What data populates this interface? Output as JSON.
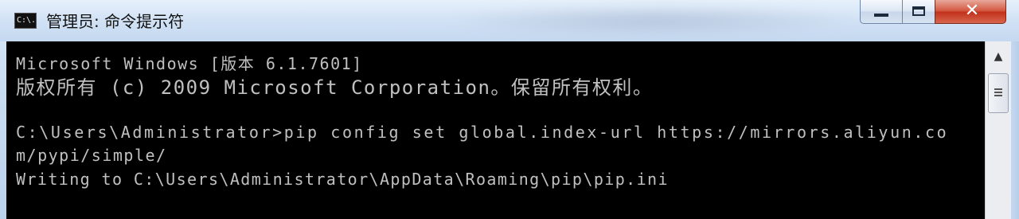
{
  "window": {
    "title": "管理员: 命令提示符",
    "icon_text": "C:\\."
  },
  "controls": {
    "minimize_icon": "minimize-icon",
    "maximize_icon": "maximize-icon",
    "close_glyph": "✕"
  },
  "console": {
    "lines": [
      "Microsoft Windows [版本 6.1.7601]",
      "版权所有 (c) 2009 Microsoft Corporation。保留所有权利。",
      "C:\\Users\\Administrator>pip config set global.index-url https://mirrors.aliyun.co",
      "m/pypi/simple/",
      "Writing to C:\\Users\\Administrator\\AppData\\Roaming\\pip\\pip.ini"
    ]
  },
  "scrollbar": {
    "up_arrow": "▲"
  },
  "colors": {
    "console_bg": "#000000",
    "console_text": "#c0c0c0",
    "close_button": "#c1301c"
  }
}
